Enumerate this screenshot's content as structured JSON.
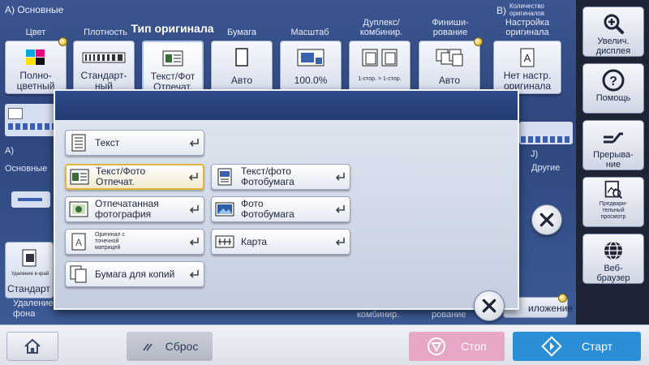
{
  "background": {
    "section_a_label": "A) Основные",
    "section_b_label": "B)",
    "section_b_small": "Количество оригиналов",
    "tabs": [
      {
        "label": "Цвет"
      },
      {
        "label": "Плотность"
      },
      {
        "label": "Тип оригинала"
      },
      {
        "label": "Бумага"
      },
      {
        "label": "Масштаб"
      },
      {
        "label": "Дуплекс/\nкомбинир."
      },
      {
        "label": "Финиши-\nрование"
      },
      {
        "label": "Настройка\nоригинала"
      }
    ],
    "tiles": [
      {
        "value": "Полно-\nцветный",
        "icon": "color-palette-icon"
      },
      {
        "value": "Стандарт-\nный",
        "icon": "density-scale-icon"
      },
      {
        "value": "Текст/Фот\nОтпечат.",
        "icon": "text-photo-icon"
      },
      {
        "value": "Авто",
        "icon": "paper-icon"
      },
      {
        "value": "100.0%",
        "icon": "zoom-icon"
      },
      {
        "value": "",
        "icon": "duplex-icon",
        "small": "1-стор. > 1-стор."
      },
      {
        "value": "Авто",
        "icon": "finishing-icon"
      },
      {
        "value": "Нет настр.\nоригинала",
        "icon": "original-setting-icon"
      }
    ],
    "left_a_label": "A)",
    "left_basic_label": "Основные",
    "right_j_label": "J)",
    "right_other_label": "Другие",
    "erase_small": "Удаление в край",
    "erase_tile_value": "Стандарт",
    "erase_label": "Удаление\nфона",
    "bottom_combine_label": "комбинир.",
    "bottom_finish_label": "рование",
    "bottom_attach_label": "иложение"
  },
  "modal": {
    "options": [
      {
        "label": "Текст",
        "icon": "text-document-icon",
        "selected": false
      },
      {
        "label": "Текст/Фото\nОтпечат.",
        "icon": "text-photo-printed-icon",
        "selected": true
      },
      {
        "label": "Текст/фото\nФотобумага",
        "icon": "text-photo-paper-icon",
        "selected": false
      },
      {
        "label": "Отпечатанная\nфотография",
        "icon": "printed-photo-icon",
        "selected": false
      },
      {
        "label": "Фото\nФотобумага",
        "icon": "photo-paper-icon",
        "selected": false
      },
      {
        "label": "Оригинал с\nточечной\nматрицей",
        "icon": "dot-matrix-icon",
        "selected": false
      },
      {
        "label": "Карта",
        "icon": "map-icon",
        "selected": false
      },
      {
        "label": "Бумага для копий",
        "icon": "copy-paper-icon",
        "selected": false
      }
    ]
  },
  "side_panel": {
    "buttons": [
      {
        "label": "Увелич.\nдисплея",
        "icon": "magnifier-plus-icon"
      },
      {
        "label": "Помощь",
        "icon": "help-icon"
      },
      {
        "label": "Прерыва-\nние",
        "icon": "interrupt-icon"
      },
      {
        "label": "Предвари-\nтельный\nпросмотр",
        "icon": "preview-icon"
      },
      {
        "label": "Веб-\nбраузер",
        "icon": "globe-icon"
      }
    ]
  },
  "bottom_bar": {
    "home_icon": "home-icon",
    "reset_label": "Сброс",
    "stop_label": "Стоп",
    "start_label": "Старт"
  },
  "colors": {
    "start": "#2a8fd6",
    "stop": "#e6a7c6",
    "selected_border": "#e2b53a",
    "header_blue": "#2e4d8c"
  }
}
